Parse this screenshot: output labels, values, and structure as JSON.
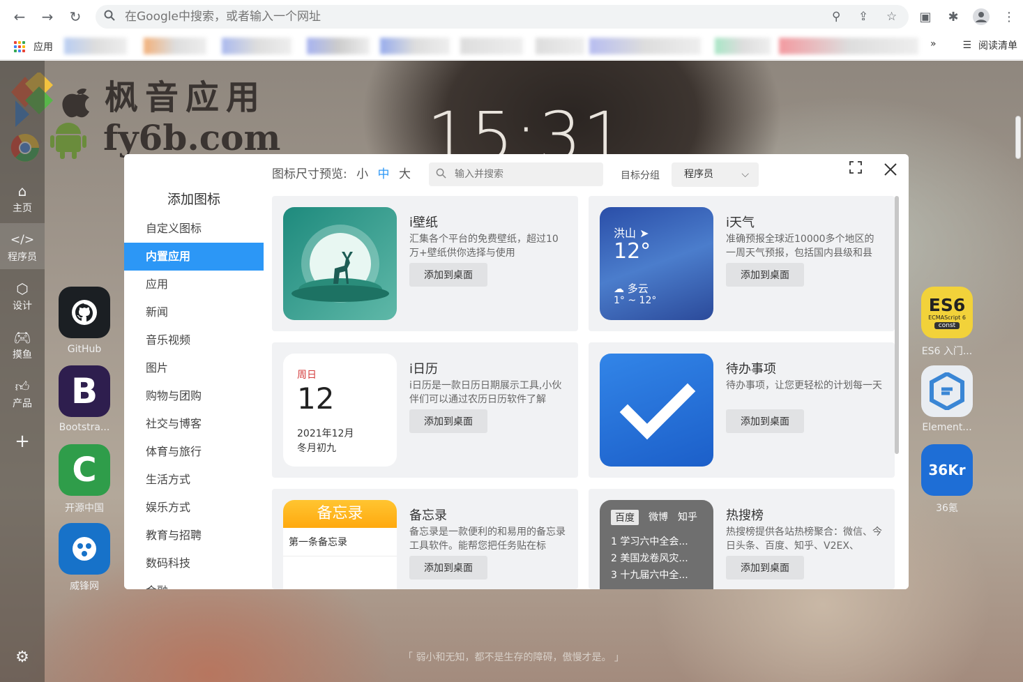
{
  "browser": {
    "omnibox_placeholder": "在Google中搜索，或者输入一个网址",
    "bookmarks_apps_label": "应用",
    "bookmarks_more": "»",
    "reading_list_label": "阅读清单"
  },
  "watermark": {
    "line1": "枫音应用",
    "line2": "fy6b.com"
  },
  "clock": "15:31",
  "leftbar": {
    "items": [
      {
        "label": "主页",
        "icon": "home-icon"
      },
      {
        "label": "程序员",
        "icon": "code-icon"
      },
      {
        "label": "设计",
        "icon": "cube-icon"
      },
      {
        "label": "摸鱼",
        "icon": "gamepad-icon"
      },
      {
        "label": "产品",
        "icon": "thumb-icon"
      }
    ],
    "add": "+"
  },
  "desktop": {
    "left_icons": [
      {
        "label": "GitHub",
        "glyph": ""
      },
      {
        "label": "Bootstra...",
        "glyph": "B"
      },
      {
        "label": "开源中国",
        "glyph": "C"
      },
      {
        "label": "威锋网",
        "glyph": ""
      }
    ],
    "right_icons": [
      {
        "label": "ES6 入门...",
        "glyph": "ES6",
        "sub1": "ECMAScript 6",
        "sub2": "const"
      },
      {
        "label": "Element...",
        "glyph": ""
      },
      {
        "label": "36氪",
        "glyph": "36Kr"
      }
    ]
  },
  "quote": "「 弱小和无知，都不是生存的障碍，傲慢才是。 」",
  "modal": {
    "title": "添加图标",
    "categories": [
      "自定义图标",
      "内置应用",
      "应用",
      "新闻",
      "音乐视频",
      "图片",
      "购物与团购",
      "社交与博客",
      "体育与旅行",
      "生活方式",
      "娱乐方式",
      "教育与招聘",
      "数码科技",
      "金融"
    ],
    "active_category": "内置应用",
    "size_preview": {
      "label": "图标尺寸预览:",
      "small": "小",
      "medium": "中",
      "large": "大",
      "selected": "中"
    },
    "search_placeholder": "输入并搜索",
    "group_label": "目标分组",
    "group_value": "程序员",
    "apps": [
      {
        "title": "i壁纸",
        "desc": "汇集各个平台的免费壁纸，超过10万+壁纸供你选择与使用",
        "button": "添加到桌面"
      },
      {
        "title": "i天气",
        "desc": "准确预报全球近10000多个地区的一周天气预报，包括国内县级和县",
        "button": "添加到桌面",
        "widget": {
          "city": "洪山",
          "temp": "12°",
          "cond": "多云",
          "range": "1° ~ 12°"
        }
      },
      {
        "title": "i日历",
        "desc": "i日历是一款日历日期展示工具,小伙伴们可以通过农历日历软件了解",
        "button": "添加到桌面",
        "widget": {
          "weekday": "周日",
          "day": "12",
          "month": "2021年12月",
          "lunar": "冬月初九"
        }
      },
      {
        "title": "待办事项",
        "desc": "待办事项，让您更轻松的计划每一天",
        "button": "添加到桌面"
      },
      {
        "title": "备忘录",
        "desc": "备忘录是一款便利的和易用的备忘录工具软件。能帮您把任务贴在标",
        "button": "添加到桌面",
        "widget": {
          "header": "备忘录",
          "item": "第一条备忘录"
        }
      },
      {
        "title": "热搜榜",
        "desc": "热搜榜提供各站热榜聚合：微信、今日头条、百度、知乎、V2EX、",
        "button": "添加到桌面",
        "widget": {
          "tabs": [
            "百度",
            "微博",
            "知乎"
          ],
          "items": [
            "1  学习六中全会...",
            "2  美国龙卷风灾...",
            "3  十九届六中全..."
          ]
        }
      }
    ]
  },
  "colors": {
    "accent": "#2c97f6",
    "card_bg": "#f1f2f4"
  }
}
